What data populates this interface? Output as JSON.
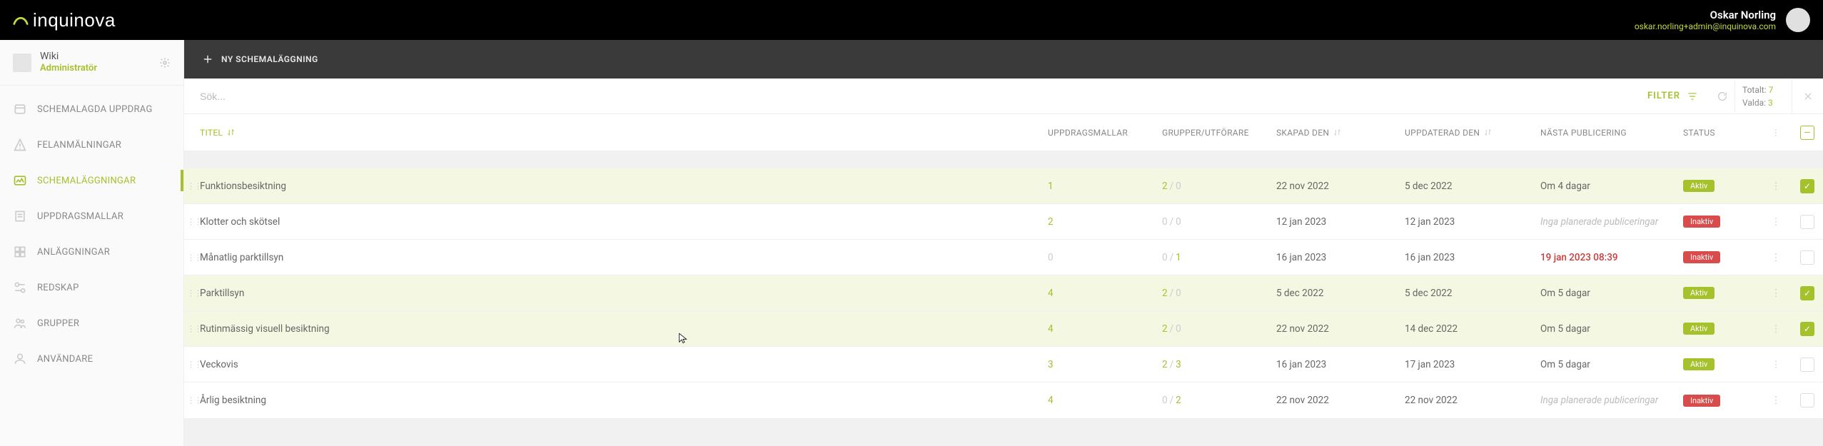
{
  "brand": "inquinova",
  "user": {
    "name": "Oskar Norling",
    "email": "oskar.norling+admin@inquinova.com"
  },
  "sidebar": {
    "wiki_title": "Wiki",
    "wiki_role": "Administratör",
    "items": [
      {
        "label": "SCHEMALAGDA UPPDRAG"
      },
      {
        "label": "FELANMÄLNINGAR"
      },
      {
        "label": "SCHEMALÄGGNINGAR"
      },
      {
        "label": "UPPDRAGSMALLAR"
      },
      {
        "label": "ANLÄGGNINGAR"
      },
      {
        "label": "REDSKAP"
      },
      {
        "label": "GRUPPER"
      },
      {
        "label": "ANVÄNDARE"
      }
    ]
  },
  "actionbar": {
    "new_label": "NY SCHEMALÄGGNING"
  },
  "search": {
    "placeholder": "Sök...",
    "filter_label": "FILTER"
  },
  "stats": {
    "total_label": "Totalt:",
    "total_value": "7",
    "selected_label": "Valda:",
    "selected_value": "3"
  },
  "headers": {
    "titel": "TITEL",
    "templates": "UPPDRAGSMALLAR",
    "groups": "GRUPPER/UTFÖRARE",
    "created": "SKAPAD DEN",
    "updated": "UPPDATERAD DEN",
    "next": "NÄSTA PUBLICERING",
    "status": "STATUS"
  },
  "badges": {
    "aktiv": "Aktiv",
    "inaktiv": "Inaktiv"
  },
  "no_planned": "Inga planerade publiceringar",
  "rows": [
    {
      "title": "Funktionsbesiktning",
      "templates": "1",
      "ga": "2",
      "gb": "0",
      "created": "22 nov 2022",
      "updated": "5 dec 2022",
      "next": "Om 4 dagar",
      "status": "aktiv",
      "selected": true
    },
    {
      "title": "Klotter och skötsel",
      "templates": "2",
      "ga": "0",
      "gb": "0",
      "created": "12 jan 2023",
      "updated": "12 jan 2023",
      "next": "",
      "status": "inaktiv",
      "selected": false
    },
    {
      "title": "Månatlig parktillsyn",
      "templates": "0",
      "ga": "0",
      "gb": "1",
      "created": "16 jan 2023",
      "updated": "16 jan 2023",
      "next": "19 jan 2023 08:39",
      "status": "inaktiv",
      "selected": false,
      "next_warn": true
    },
    {
      "title": "Parktillsyn",
      "templates": "4",
      "ga": "2",
      "gb": "0",
      "created": "5 dec 2022",
      "updated": "5 dec 2022",
      "next": "Om 5 dagar",
      "status": "aktiv",
      "selected": true
    },
    {
      "title": "Rutinmässig visuell besiktning",
      "templates": "4",
      "ga": "2",
      "gb": "0",
      "created": "22 nov 2022",
      "updated": "14 dec 2022",
      "next": "Om 5 dagar",
      "status": "aktiv",
      "selected": true
    },
    {
      "title": "Veckovis",
      "templates": "3",
      "ga": "2",
      "gb": "3",
      "created": "16 jan 2023",
      "updated": "17 jan 2023",
      "next": "Om 5 dagar",
      "status": "aktiv",
      "selected": false
    },
    {
      "title": "Årlig besiktning",
      "templates": "4",
      "ga": "0",
      "gb": "2",
      "created": "22 nov 2022",
      "updated": "22 nov 2022",
      "next": "",
      "status": "inaktiv",
      "selected": false
    }
  ]
}
